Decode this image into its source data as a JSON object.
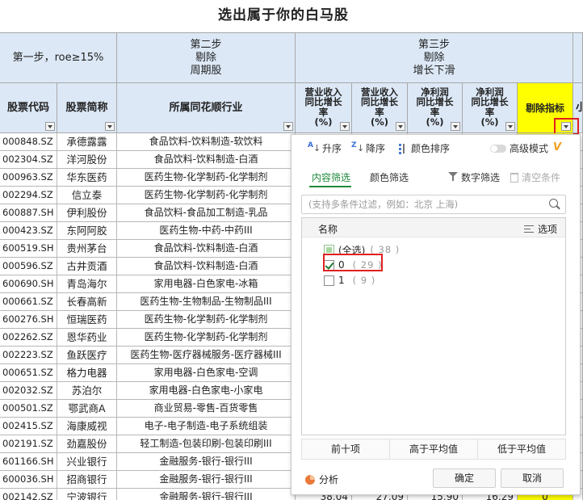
{
  "sheet": {
    "title": "选出属于你的白马股",
    "step1": "第一步，roe≥15%",
    "step2": "第二步\n剔除\n周期股",
    "step3": "第三步\n剔除\n增长下滑",
    "columns": {
      "code": "股票代码",
      "name": "股票简称",
      "industry": "所属同花顺行业",
      "revenue_growth": "营业收入\n同比增长\n率\n(%)",
      "revenue_growth_2": "营业收入\n同比增长\n率\n(%)",
      "profit_growth": "净利润\n同比增长\n率\n(%)",
      "profit_growth_2": "净利润\n同比增长\n率\n(%)",
      "exclude_indicator": "剔除指标",
      "partial_next": "小"
    },
    "rows": [
      {
        "code": "000848.SZ",
        "name": "承德露露",
        "industry": "食品饮料-饮料制造-软饮料"
      },
      {
        "code": "002304.SZ",
        "name": "洋河股份",
        "industry": "食品饮料-饮料制造-白酒"
      },
      {
        "code": "000963.SZ",
        "name": "华东医药",
        "industry": "医药生物-化学制药-化学制剂"
      },
      {
        "code": "002294.SZ",
        "name": "信立泰",
        "industry": "医药生物-化学制药-化学制剂"
      },
      {
        "code": "600887.SH",
        "name": "伊利股份",
        "industry": "食品饮料-食品加工制造-乳品"
      },
      {
        "code": "000423.SZ",
        "name": "东阿阿胶",
        "industry": "医药生物-中药-中药III"
      },
      {
        "code": "600519.SH",
        "name": "贵州茅台",
        "industry": "食品饮料-饮料制造-白酒"
      },
      {
        "code": "000596.SZ",
        "name": "古井贡酒",
        "industry": "食品饮料-饮料制造-白酒"
      },
      {
        "code": "600690.SH",
        "name": "青岛海尔",
        "industry": "家用电器-白色家电-冰箱"
      },
      {
        "code": "000661.SZ",
        "name": "长春高新",
        "industry": "医药生物-生物制品-生物制品III"
      },
      {
        "code": "600276.SH",
        "name": "恒瑞医药",
        "industry": "医药生物-化学制药-化学制剂"
      },
      {
        "code": "002262.SZ",
        "name": "恩华药业",
        "industry": "医药生物-化学制药-化学制剂"
      },
      {
        "code": "002223.SZ",
        "name": "鱼跃医疗",
        "industry": "医药生物-医疗器械服务-医疗器械III"
      },
      {
        "code": "000651.SZ",
        "name": "格力电器",
        "industry": "家用电器-白色家电-空调"
      },
      {
        "code": "002032.SZ",
        "name": "苏泊尔",
        "industry": "家用电器-白色家电-小家电"
      },
      {
        "code": "000501.SZ",
        "name": "鄂武商A",
        "industry": "商业贸易-零售-百货零售"
      },
      {
        "code": "002415.SZ",
        "name": "海康威视",
        "industry": "电子-电子制造-电子系统组装"
      },
      {
        "code": "002191.SZ",
        "name": "劲嘉股份",
        "industry": "轻工制造-包装印刷-包装印刷III"
      },
      {
        "code": "601166.SH",
        "name": "兴业银行",
        "industry": "金融服务-银行-银行III"
      },
      {
        "code": "600036.SH",
        "name": "招商银行",
        "industry": "金融服务-银行-银行III"
      },
      {
        "code": "002142.SZ",
        "name": "宁波银行",
        "industry": "金融服务-银行-银行III",
        "n1": "38.04",
        "n2": "27.09",
        "n3": "15.90",
        "n4": "16.29",
        "flag": "0"
      }
    ]
  },
  "filter_popup": {
    "sort_asc": "升序",
    "sort_desc": "降序",
    "sort_color": "颜色排序",
    "advanced_mode": "高级模式",
    "vip_badge": "V",
    "tab_content": "内容筛选",
    "tab_color": "颜色筛选",
    "number_filter": "数字筛选",
    "clear_conditions": "清空条件",
    "search_placeholder": "(支持多条件过滤，例如：北京 上海)",
    "list_header": "名称",
    "options_label": "选项",
    "items": [
      {
        "label": "(全选)",
        "count": "( 38 )",
        "state": "partial"
      },
      {
        "label": "0",
        "count": "( 29 )",
        "state": "checked"
      },
      {
        "label": "1",
        "count": "( 9 )",
        "state": "unchecked"
      }
    ],
    "top10": "前十项",
    "above_avg": "高于平均值",
    "below_avg": "低于平均值",
    "analyze": "分析",
    "ok": "确定",
    "cancel": "取消"
  },
  "colors": {
    "header_bg": "#dce8f6",
    "highlight_column": "#ffff00",
    "accent_green": "#1d8a3a",
    "annotation_red": "#e02020"
  }
}
